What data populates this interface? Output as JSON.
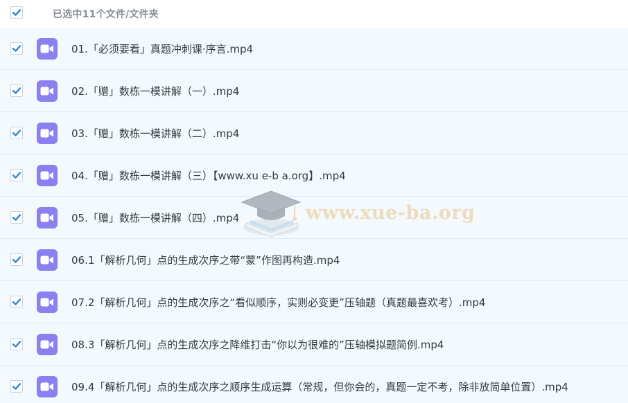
{
  "header": {
    "title": "已选中11个文件/文件夹",
    "checked": true
  },
  "files": [
    {
      "name": "01.「必须要看」真题冲刺课·序言.mp4",
      "checked": true,
      "icon": "video-file-icon"
    },
    {
      "name": "02.「赠」数栋一模讲解（一）.mp4",
      "checked": true,
      "icon": "video-file-icon"
    },
    {
      "name": "03.「赠」数栋一模讲解（二）.mp4",
      "checked": true,
      "icon": "video-file-icon"
    },
    {
      "name": "04.「赠」数栋一模讲解（三）【www.xu e-b a.org】.mp4",
      "checked": true,
      "icon": "video-file-icon"
    },
    {
      "name": "05.「赠」数栋一模讲解（四）.mp4",
      "checked": true,
      "icon": "video-file-icon"
    },
    {
      "name": "06.1「解析几何」点的生成次序之带“蒙”作图再构造.mp4",
      "checked": true,
      "icon": "video-file-icon"
    },
    {
      "name": "07.2「解析几何」点的生成次序之“看似顺序，实则必变更”压轴题（真题最喜欢考）.mp4",
      "checked": true,
      "icon": "video-file-icon"
    },
    {
      "name": "08.3「解析几何」点的生成次序之降维打击“你以为很难的”压轴模拟题简例.mp4",
      "checked": true,
      "icon": "video-file-icon"
    },
    {
      "name": "09.4「解析几何」点的生成次序之顺序生成运算（常规，但你会的，真题一定不考，除非放简单位置）.mp4",
      "checked": true,
      "icon": "video-file-icon"
    }
  ],
  "watermark": {
    "text": "www.xue-ba.org",
    "icon": "graduation-cap-icon"
  },
  "colors": {
    "checkbox_accent": "#2f86d8",
    "file_icon_bg": "#8c7ff0",
    "row_bg": "#f3f9fd",
    "row_border": "#dfeaf4",
    "watermark": "#e8c489"
  }
}
